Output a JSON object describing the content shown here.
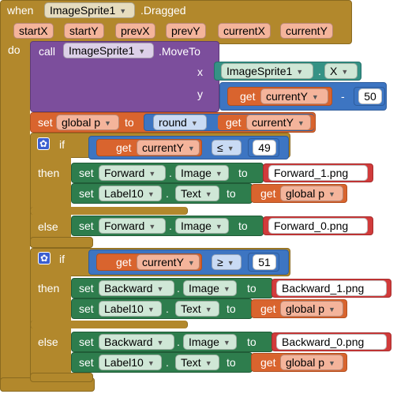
{
  "event": {
    "when": "when",
    "component": "ImageSprite1",
    "event_name": ".Dragged",
    "do": "do",
    "params": [
      "startX",
      "startY",
      "prevX",
      "prevY",
      "currentX",
      "currentY"
    ]
  },
  "call_block": {
    "call": "call",
    "component": "ImageSprite1",
    "method": ".MoveTo",
    "x_label": "x",
    "y_label": "y",
    "x_value": {
      "component": "ImageSprite1",
      "dot": ".",
      "property": "X"
    },
    "y_value": {
      "get": "get",
      "var": "currentY",
      "op": "-",
      "num": "50"
    }
  },
  "set_global": {
    "set": "set",
    "var": "global p",
    "to": "to",
    "round": "round",
    "get": "get",
    "arg": "currentY"
  },
  "if1": {
    "if": "if",
    "then": "then",
    "else": "else",
    "get": "get",
    "var": "currentY",
    "op": "≤",
    "num": "49",
    "then_rows": [
      {
        "set": "set",
        "component": "Forward",
        "dot": ".",
        "property": "Image",
        "to": "to",
        "value": "Forward_1.png"
      },
      {
        "set": "set",
        "component": "Label10",
        "dot": ".",
        "property": "Text",
        "to": "to",
        "get": "get",
        "value": "global p"
      }
    ],
    "else_rows": [
      {
        "set": "set",
        "component": "Forward",
        "dot": ".",
        "property": "Image",
        "to": "to",
        "value": "Forward_0.png"
      }
    ]
  },
  "if2": {
    "if": "if",
    "then": "then",
    "else": "else",
    "get": "get",
    "var": "currentY",
    "op": "≥",
    "num": "51",
    "then_rows": [
      {
        "set": "set",
        "component": "Backward",
        "dot": ".",
        "property": "Image",
        "to": "to",
        "value": "Backward_1.png"
      },
      {
        "set": "set",
        "component": "Label10",
        "dot": ".",
        "property": "Text",
        "to": "to",
        "get": "get",
        "value": "global p"
      }
    ],
    "else_rows": [
      {
        "set": "set",
        "component": "Backward",
        "dot": ".",
        "property": "Image",
        "to": "to",
        "value": "Backward_0.png"
      },
      {
        "set": "set",
        "component": "Label10",
        "dot": ".",
        "property": "Text",
        "to": "to",
        "get": "get",
        "value": "global p"
      }
    ]
  },
  "icons": {
    "dropdown": "chevron-down-icon",
    "mutator": "gear-icon"
  },
  "colors": {
    "event": "#b2882c",
    "call": "#7c4e9c",
    "variable": "#d9642e",
    "math": "#3d75c2",
    "setter": "#2e7d4d",
    "getter": "#359285",
    "text": "#d13b3b",
    "control": "#b2882c"
  }
}
